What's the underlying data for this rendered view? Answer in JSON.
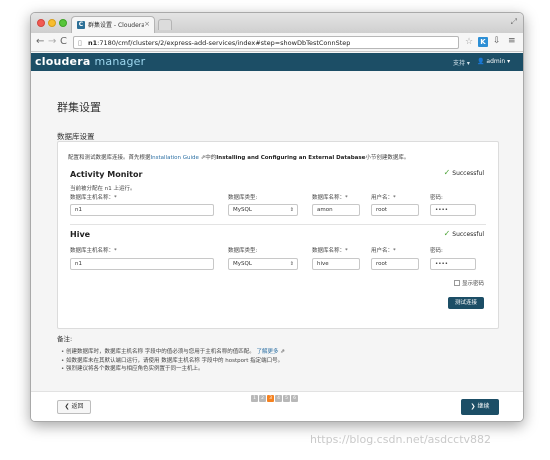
{
  "browser": {
    "tab_title": "群集设置 - Cloudera Manag",
    "tab_close": "×",
    "url_host": "n1",
    "url_rest": ":7180/cmf/clusters/2/express-add-services/index#step=showDbTestConnStep",
    "ext_k_label": "K"
  },
  "header": {
    "logo_a": "cloudera",
    "logo_b": "manager",
    "support": "支持 ▾",
    "user": "admin ▾",
    "user_icon": "person-icon"
  },
  "page": {
    "title": "群集设置",
    "section": "数据库设置",
    "intro_pre": "配置和测试数据库连接。首先根据",
    "intro_link": "Installation Guide",
    "intro_mid": "中的",
    "intro_bold": "Installing and Configuring an External Database",
    "intro_post": "小节创建数据库。"
  },
  "labels": {
    "host": "数据库主机名称：*",
    "type": "数据库类型:",
    "name": "数据库名称：*",
    "user": "用户名：*",
    "password": "密码:",
    "status": "Successful"
  },
  "services": {
    "activity_monitor": {
      "name": "Activity Monitor",
      "runs_on": "当前被分配在 n1 上运行。",
      "host": "n1",
      "type": "MySQL",
      "db_name": "amon",
      "user": "root",
      "password": "••••"
    },
    "hive": {
      "name": "Hive",
      "host": "n1",
      "type": "MySQL",
      "db_name": "hive",
      "user": "root",
      "password": "••••"
    }
  },
  "actions": {
    "show_password": "显示密码",
    "test_connection": "测试连接",
    "back": "返回",
    "continue": "继续"
  },
  "notes": {
    "title": "备注:",
    "item1": "创建数据库时，数据库主机名称 字段中的值必须与您用于主机名称的值匹配。",
    "item1_link": "了解更多",
    "item2": "如数据库未在其默认端口运行，请使用 数据库主机名称 字段中的 hostport 指定端口号。",
    "item3": "强烈建议将各个数据库与相应角色实例置于同一主机上。"
  },
  "steps": {
    "labels": [
      "1",
      "2",
      "3",
      "4",
      "5",
      "6"
    ],
    "current": 3
  },
  "watermark": "https://blog.csdn.net/asdcctv882",
  "colors": {
    "header": "#1c4e66",
    "primary_button": "#1c4e66",
    "success": "#4aa235",
    "active_step": "#f58220",
    "link": "#2b6fa3"
  }
}
